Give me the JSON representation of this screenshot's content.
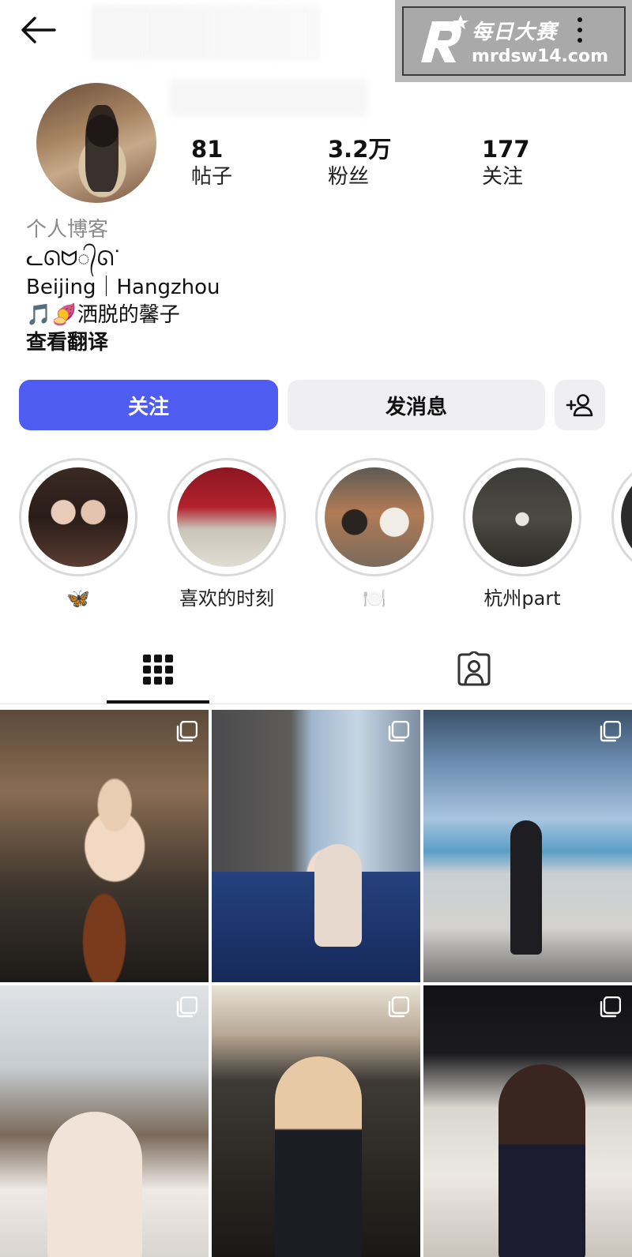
{
  "header": {
    "back_icon": "arrow-left-icon",
    "more_icon": "more-vertical-icon"
  },
  "watermark": {
    "logo_letter": "R",
    "cn_text": "每日大赛",
    "url": "mrdsw14.com"
  },
  "profile": {
    "stats": [
      {
        "value": "81",
        "label": "帖子"
      },
      {
        "value": "3.2万",
        "label": "粉丝"
      },
      {
        "value": "177",
        "label": "关注"
      }
    ],
    "category": "个人博客",
    "bio": {
      "line1": "ᓚᘏᗢ᭄ᘏᐝ",
      "line2": "Beijing｜Hangzhou",
      "line3": "🎵🍠洒脱的馨子",
      "translate": "查看翻译"
    }
  },
  "actions": {
    "follow": "关注",
    "message": "发消息",
    "add_user_icon": "add-user-icon"
  },
  "highlights": [
    {
      "label": "🦋"
    },
    {
      "label": "喜欢的时刻"
    },
    {
      "label": "🍽️"
    },
    {
      "label": "杭州part"
    }
  ],
  "tabs": [
    {
      "icon": "grid-icon",
      "active": true
    },
    {
      "icon": "tagged-person-icon",
      "active": false
    }
  ],
  "colors": {
    "follow_button": "#4f5cf2",
    "secondary_button": "#efeff1"
  }
}
